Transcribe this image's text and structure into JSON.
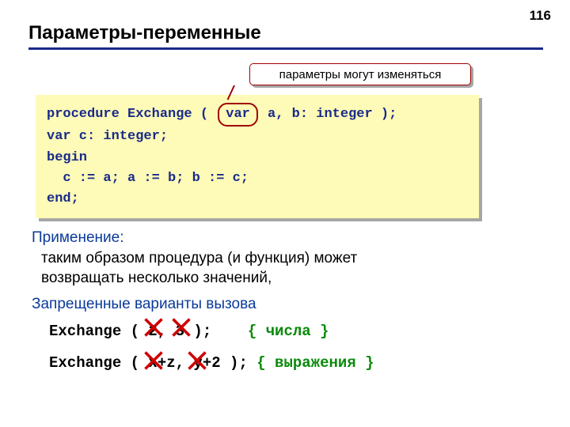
{
  "page_number": "116",
  "title": "Параметры-переменные",
  "callout": "параметры могут изменяться",
  "code": {
    "l1a": "procedure Exchange ( ",
    "l1_var": "var",
    "l1b": " a, b: integer );",
    "l2": "var c: integer;",
    "l3": "begin",
    "l4": "  c := a; a := b; b := c;",
    "l5": "end;"
  },
  "apply": {
    "label": "Применение:",
    "body1": "таким образом процедура (и функция) может",
    "body2": "возвращать несколько значений,"
  },
  "forbidden": {
    "label": "Запрещенные варианты вызова",
    "line1_code": "Exchange ( 2, 3 );    ",
    "line1_comment": "{ числа }",
    "line2_code": "Exchange ( x+z, y+2 ); ",
    "line2_comment": "{ выражения }"
  }
}
